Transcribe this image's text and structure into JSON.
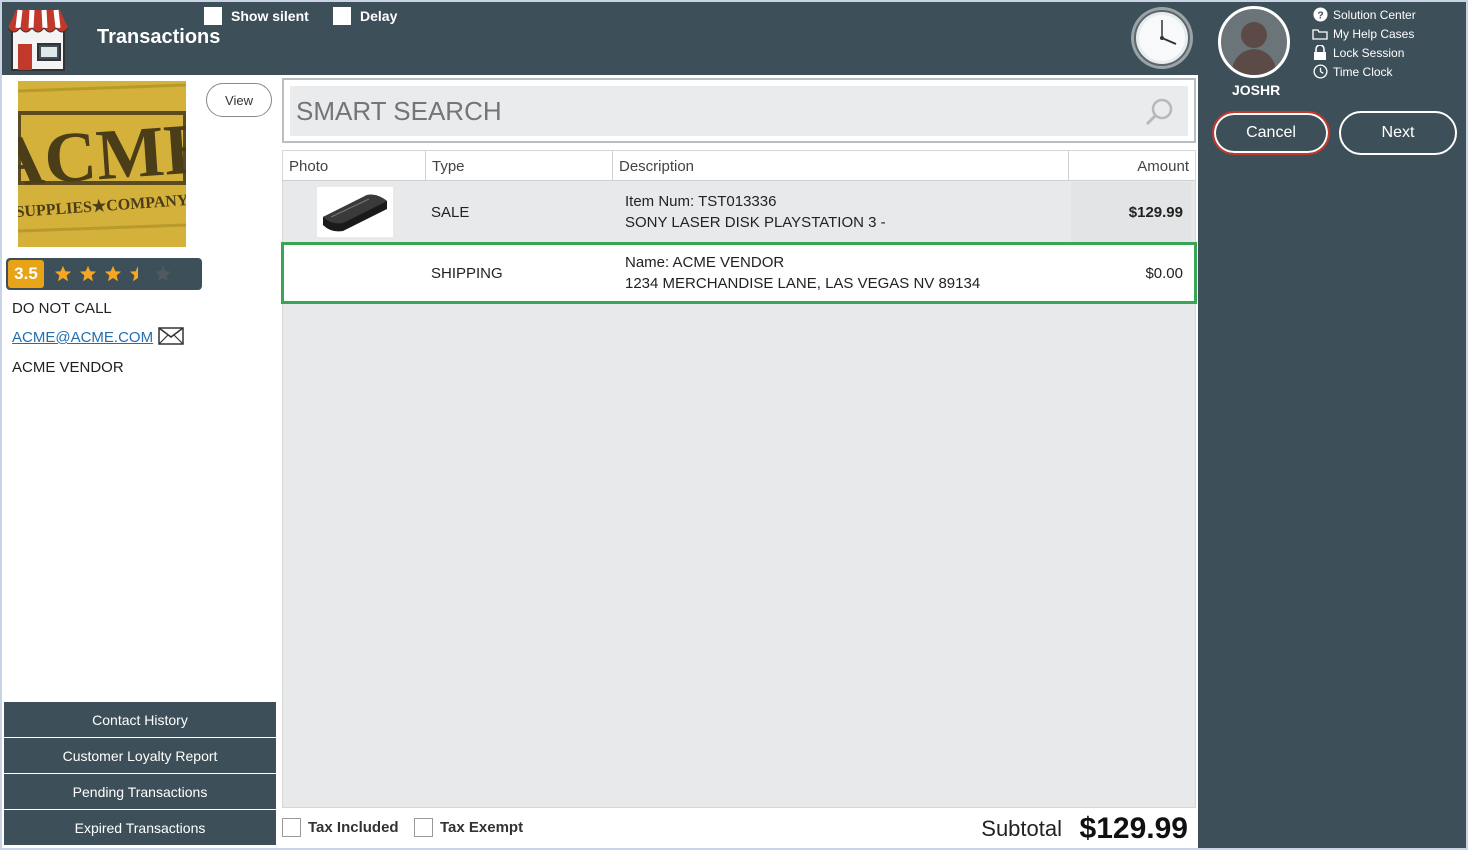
{
  "header": {
    "title": "Transactions",
    "show_silent_label": "Show silent",
    "delay_label": "Delay"
  },
  "user": {
    "name": "JOSHR",
    "links": [
      "Solution Center",
      "My Help Cases",
      "Lock Session",
      "Time Clock"
    ],
    "cancel_label": "Cancel",
    "next_label": "Next"
  },
  "customer": {
    "view_label": "View",
    "rating": "3.5",
    "stars_filled": 3.5,
    "stars_total": 5,
    "note": "DO NOT CALL",
    "email": "ACME@ACME.COM",
    "name": "ACME VENDOR",
    "side_buttons": [
      "Contact History",
      "Customer Loyalty Report",
      "Pending Transactions",
      "Expired Transactions"
    ]
  },
  "search": {
    "placeholder": "SMART SEARCH"
  },
  "table": {
    "headers": [
      "Photo",
      "Type",
      "Description",
      "Amount"
    ],
    "rows": [
      {
        "type": "SALE",
        "desc_line1": "Item Num: TST013336",
        "desc_line2": "SONY LASER DISK PLAYSTATION 3 -",
        "amount": "$129.99"
      },
      {
        "type": "SHIPPING",
        "desc_line1": "Name: ACME VENDOR",
        "desc_line2": "1234 MERCHANDISE LANE, LAS VEGAS NV 89134",
        "amount": "$0.00"
      }
    ]
  },
  "footer": {
    "tax_included_label": "Tax Included",
    "tax_exempt_label": "Tax Exempt",
    "subtotal_label": "Subtotal",
    "subtotal_value": "$129.99"
  },
  "icons": {
    "store": "store-icon",
    "clock": "wall-clock-icon",
    "help": "question-circle-icon",
    "folder": "folder-icon",
    "lock": "lock-icon",
    "time": "clock-icon",
    "mail": "envelope-icon",
    "search": "magnifier-icon"
  }
}
